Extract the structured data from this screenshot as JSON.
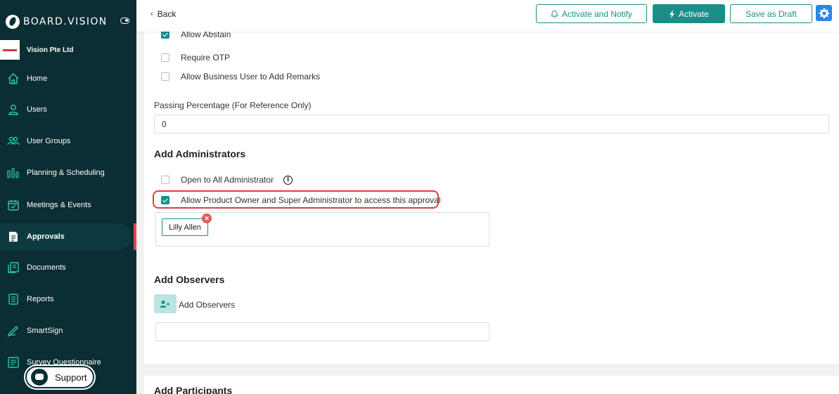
{
  "app": {
    "name": "BOARD.VISION"
  },
  "org": {
    "name": "Vision Pte Ltd"
  },
  "sidebar": {
    "items": [
      {
        "label": "Home",
        "icon": "home-icon"
      },
      {
        "label": "Users",
        "icon": "user-icon"
      },
      {
        "label": "User Groups",
        "icon": "user-groups-icon"
      },
      {
        "label": "Planning & Scheduling",
        "icon": "planning-icon"
      },
      {
        "label": "Meetings & Events",
        "icon": "calendar-icon"
      },
      {
        "label": "Approvals",
        "icon": "approvals-icon",
        "active": true
      },
      {
        "label": "Documents",
        "icon": "documents-icon"
      },
      {
        "label": "Reports",
        "icon": "reports-icon"
      },
      {
        "label": "SmartSign",
        "icon": "smartsign-icon"
      },
      {
        "label": "Survey Questionnaire",
        "icon": "survey-icon"
      }
    ],
    "support_label": "Support"
  },
  "topbar": {
    "back_label": "Back",
    "activate_notify_label": "Activate and Notify",
    "activate_label": "Activate",
    "save_draft_label": "Save as Draft"
  },
  "options": {
    "allow_abstain": {
      "label": "Allow Abstain",
      "checked": true
    },
    "require_otp": {
      "label": "Require OTP",
      "checked": false
    },
    "allow_remarks": {
      "label": "Allow Business User to Add Remarks",
      "checked": false
    }
  },
  "passing": {
    "label": "Passing Percentage (For Reference Only)",
    "value": "0"
  },
  "administrators": {
    "title": "Add Administrators",
    "open_to_all": {
      "label": "Open to All Administrator",
      "checked": false
    },
    "allow_owner": {
      "label": "Allow Product Owner and Super Administrator to access this approval",
      "checked": true
    },
    "selected": [
      "Lilly Allen"
    ]
  },
  "observers": {
    "title": "Add Observers",
    "button_label": "Add Observers"
  },
  "participants": {
    "title": "Add Participants"
  },
  "colors": {
    "sidebar_bg": "#0a2e33",
    "accent": "#1a8f8a",
    "highlight": "#d9423b",
    "settings_blue": "#2c86e8"
  }
}
